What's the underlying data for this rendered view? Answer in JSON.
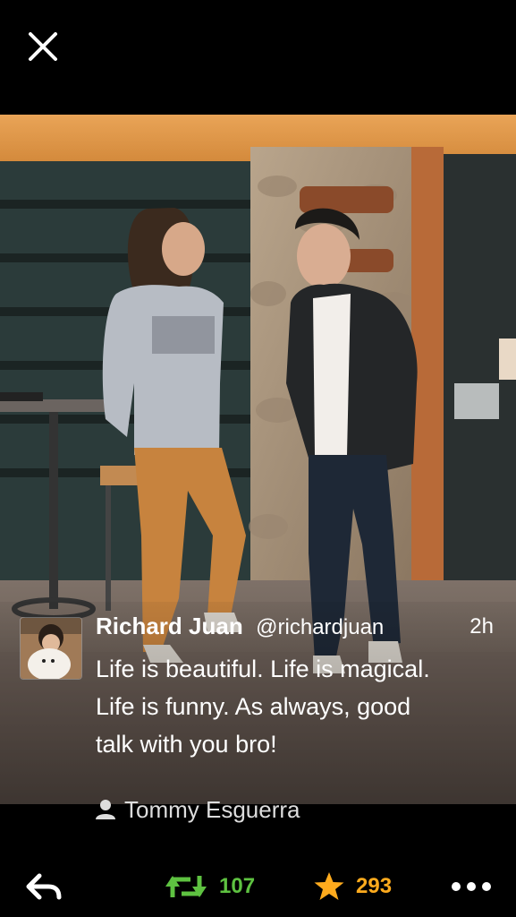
{
  "icons": {
    "close": "close-icon",
    "reply": "reply-icon",
    "retweet": "retweet-icon",
    "favorite": "star-icon",
    "more": "more-icon",
    "person": "person-icon"
  },
  "colors": {
    "retweet": "#5ec241",
    "favorite": "#ffab1d",
    "background": "#000000",
    "text": "#ffffff"
  },
  "tweet": {
    "name": "Richard Juan",
    "handle": "@richardjuan",
    "time": "2h",
    "text_lines": [
      "Life is beautiful. Life is magical.",
      "Life is funny. As always, good",
      "talk with you bro!"
    ]
  },
  "credit": {
    "name": "Tommy Esguerra"
  },
  "actions": {
    "retweet_count": "107",
    "favorite_count": "293"
  }
}
